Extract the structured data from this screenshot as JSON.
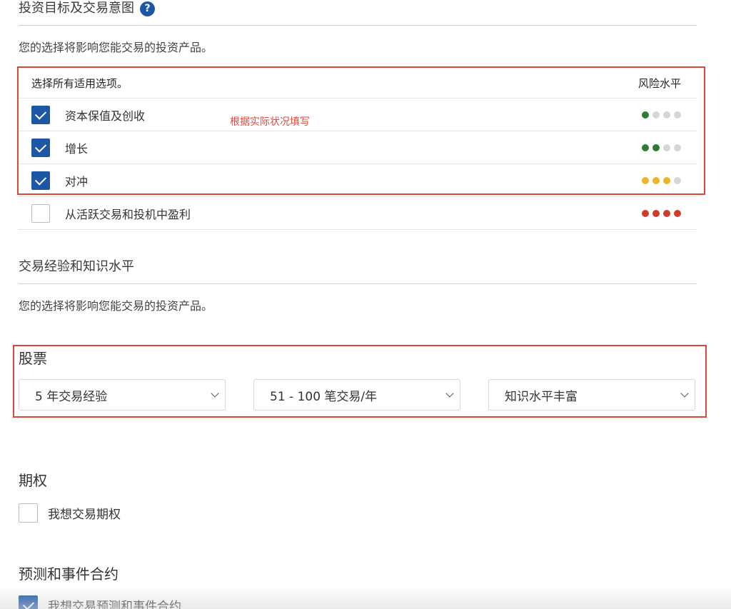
{
  "objectives": {
    "title": "投资目标及交易意图",
    "help_icon": "?",
    "description": "您的选择将影响您能交易的投资产品。",
    "header_left": "选择所有适用选项。",
    "header_right": "风险水平",
    "annotation": "根据实际状况填写",
    "items": [
      {
        "label": "资本保值及创收",
        "checked": true,
        "risk": [
          "#2e7d32",
          "#d6d6d6",
          "#d6d6d6",
          "#d6d6d6"
        ]
      },
      {
        "label": "增长",
        "checked": true,
        "risk": [
          "#2e7d32",
          "#2e7d32",
          "#d6d6d6",
          "#d6d6d6"
        ]
      },
      {
        "label": "对冲",
        "checked": true,
        "risk": [
          "#f0b429",
          "#f0b429",
          "#f0b429",
          "#d6d6d6"
        ]
      },
      {
        "label": "从活跃交易和投机中盈利",
        "checked": false,
        "risk": [
          "#d23a2f",
          "#d23a2f",
          "#d23a2f",
          "#d23a2f"
        ]
      }
    ]
  },
  "experience": {
    "title": "交易经验和知识水平",
    "description": "您的选择将影响您能交易的投资产品。",
    "stocks": {
      "title": "股票",
      "years": "5 年交易经验",
      "trades": "51 - 100 笔交易/年",
      "knowledge": "知识水平丰富"
    },
    "options": {
      "title": "期权",
      "checkbox_label": "我想交易期权",
      "checked": false
    },
    "prediction": {
      "title": "预测和事件合约",
      "checkbox_label": "我想交易预测和事件合约",
      "checked": true
    }
  },
  "colors": {
    "accent": "#1e56a6",
    "highlight_box": "#d9473a",
    "annotation": "#e24a3c"
  }
}
